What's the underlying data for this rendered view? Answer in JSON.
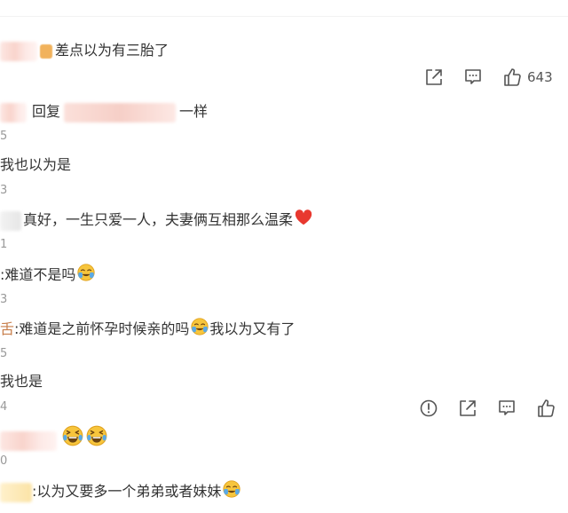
{
  "comments": [
    {
      "text": "差点以为有三胎了"
    },
    {
      "reply_prefix": "回复",
      "text": "一样"
    },
    {
      "text": "我也以为是"
    },
    {
      "text": "真好，一生只爱一人，夫妻俩互相那么温柔"
    },
    {
      "text": ":难道不是吗"
    },
    {
      "prefix": "舌",
      "text": ":难道是之前怀孕时候亲的吗",
      "text_after": "我以为又有了"
    },
    {
      "text": "我也是"
    },
    {
      "text": ""
    },
    {
      "text": ":以为又要多一个弟弟或者妹妹"
    }
  ],
  "edge_numbers": [
    "5",
    "3",
    "1",
    "3",
    "5",
    "4",
    "0"
  ],
  "top_actions": {
    "icons": [
      "share-icon",
      "comment-icon",
      "like-icon"
    ],
    "like_count": "643"
  },
  "bottom_actions": {
    "icons": [
      "report-icon",
      "share-icon",
      "comment-icon",
      "like-icon"
    ]
  },
  "colors": {
    "text": "#333333",
    "muted": "#999999",
    "icon": "#555555",
    "heart": "#e8382f",
    "emoji_yellow": "#f7c53c",
    "tear_blue": "#5aa9e6"
  }
}
